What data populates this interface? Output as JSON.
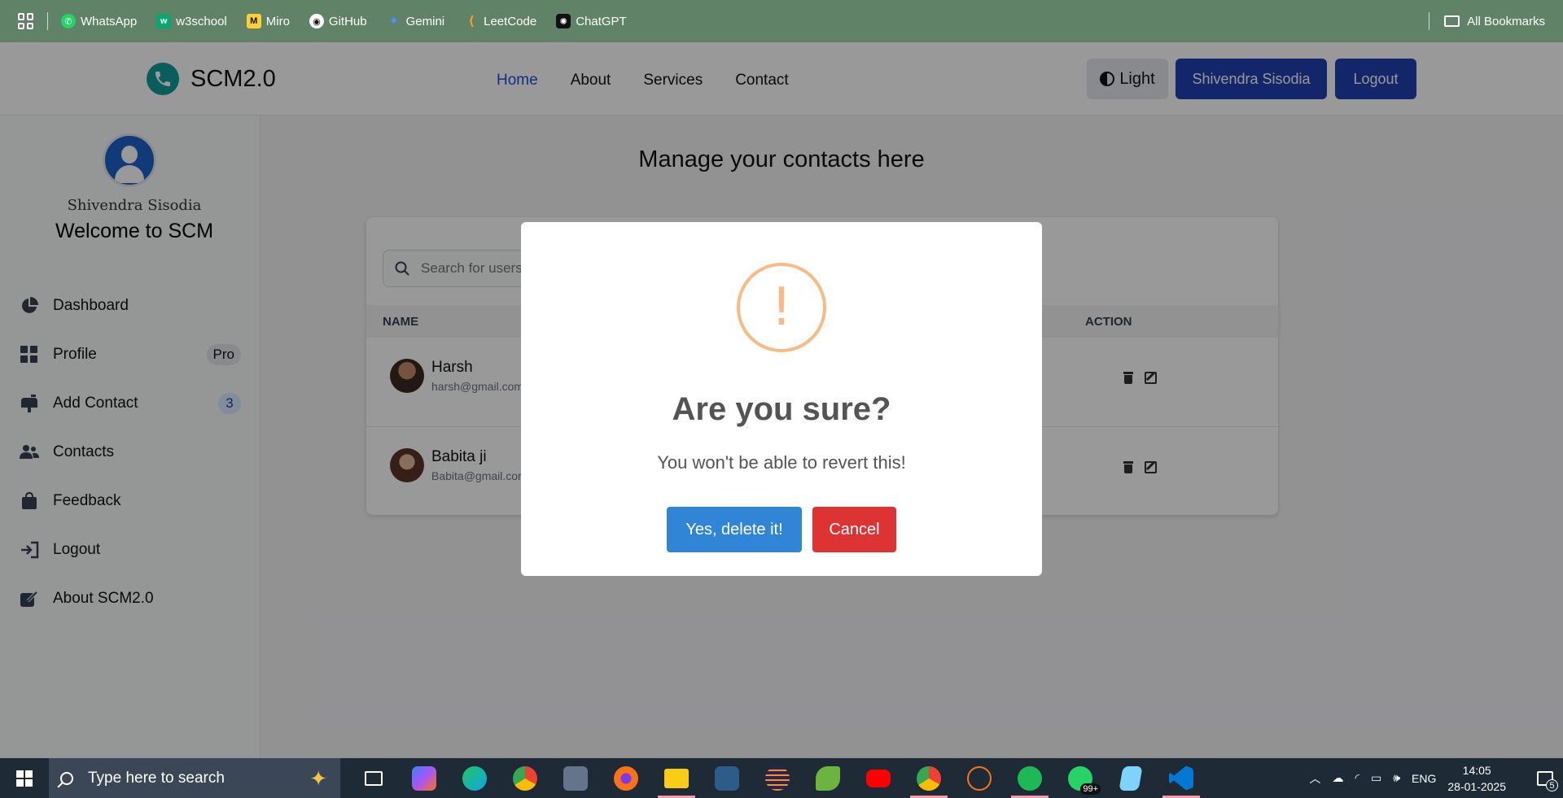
{
  "bookmarks": {
    "items": [
      {
        "label": "WhatsApp",
        "icon": "whatsapp-icon",
        "color": "#25d366"
      },
      {
        "label": "w3school",
        "icon": "w3school-icon",
        "color": "#04aa6d"
      },
      {
        "label": "Miro",
        "icon": "miro-icon",
        "color": "#ffd02f"
      },
      {
        "label": "GitHub",
        "icon": "github-icon",
        "color": "#ffffff"
      },
      {
        "label": "Gemini",
        "icon": "gemini-icon",
        "color": "#4e8cff"
      },
      {
        "label": "LeetCode",
        "icon": "leetcode-icon",
        "color": "#ffa116"
      },
      {
        "label": "ChatGPT",
        "icon": "chatgpt-icon",
        "color": "#111111"
      }
    ],
    "all_label": "All Bookmarks"
  },
  "navbar": {
    "brand": "SCM2.0",
    "links": [
      "Home",
      "About",
      "Services",
      "Contact"
    ],
    "active_link": "Home",
    "theme_label": "Light",
    "user_label": "Shivendra Sisodia",
    "logout_label": "Logout"
  },
  "sidebar": {
    "user_name": "Shivendra Sisodia",
    "welcome": "Welcome to SCM",
    "items": [
      {
        "label": "Dashboard",
        "icon": "chart-pie-icon"
      },
      {
        "label": "Profile",
        "icon": "grid-icon",
        "badge": "Pro"
      },
      {
        "label": "Add Contact",
        "icon": "mailbox-icon",
        "badge": "3"
      },
      {
        "label": "Contacts",
        "icon": "users-icon"
      },
      {
        "label": "Feedback",
        "icon": "bag-icon"
      },
      {
        "label": "Logout",
        "icon": "sign-out-icon"
      },
      {
        "label": "About SCM2.0",
        "icon": "pen-square-icon"
      }
    ]
  },
  "main": {
    "title": "Manage your contacts here",
    "search_placeholder": "Search for users",
    "columns": {
      "name": "NAME",
      "action": "ACTION"
    },
    "rows": [
      {
        "name": "Harsh",
        "email": "harsh@gmail.com"
      },
      {
        "name": "Babita ji",
        "email": "Babita@gmail.com"
      }
    ]
  },
  "modal": {
    "icon": "!",
    "title": "Are you sure?",
    "text": "You won't be able to revert this!",
    "confirm_label": "Yes, delete it!",
    "cancel_label": "Cancel",
    "colors": {
      "confirm": "#3085d6",
      "cancel": "#dd3333",
      "warning": "#f8bb86"
    }
  },
  "taskbar": {
    "search_placeholder": "Type here to search",
    "whatsapp_count": "99+",
    "language": "ENG",
    "time": "14:05",
    "date": "28-01-2025",
    "notifications": "5"
  }
}
